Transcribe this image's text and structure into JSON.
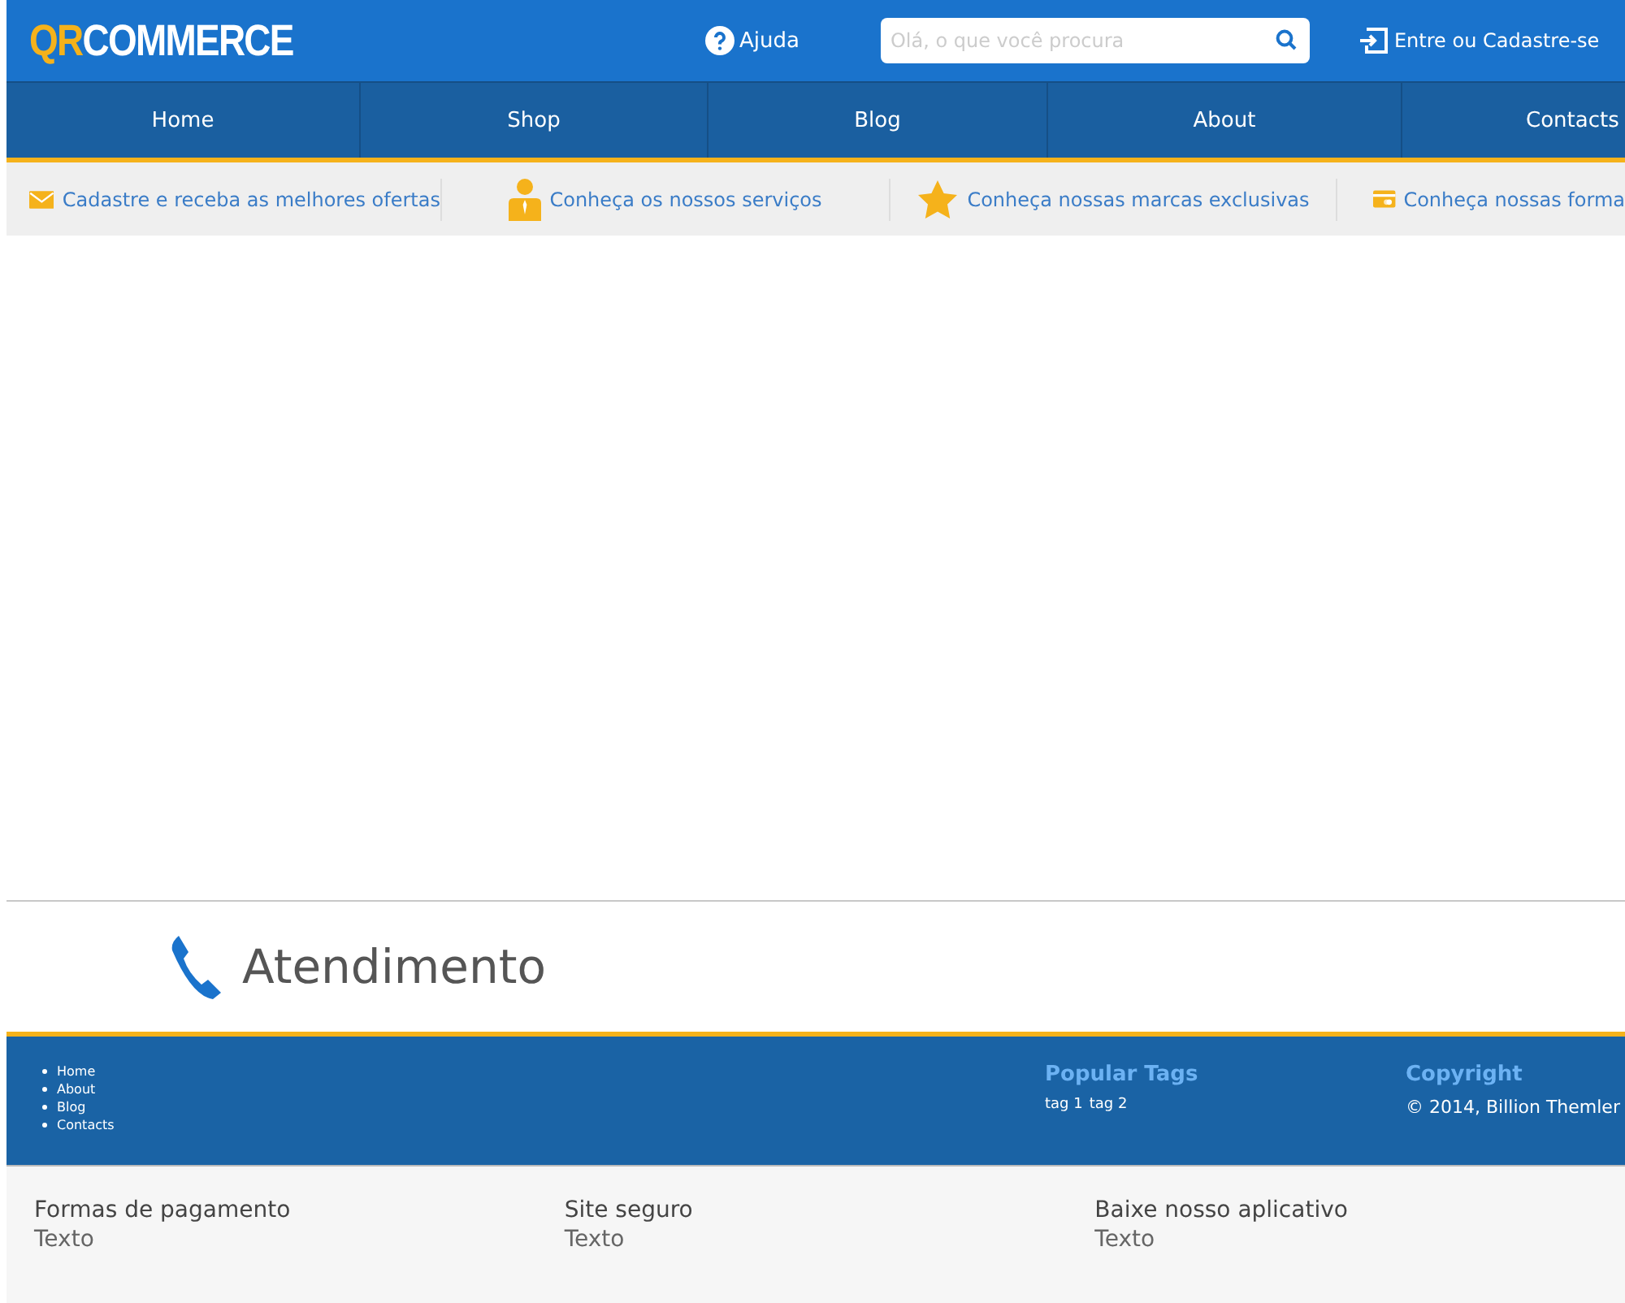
{
  "header": {
    "logo": {
      "prefix": "QR",
      "name": "COMMERCE"
    },
    "help": "Ajuda",
    "search": {
      "placeholder": "Olá, o que você procura"
    },
    "login": "Entre ou Cadastre-se"
  },
  "nav": [
    {
      "label": "Home"
    },
    {
      "label": "Shop"
    },
    {
      "label": "Blog"
    },
    {
      "label": "About"
    },
    {
      "label": "Contacts"
    }
  ],
  "promos": [
    {
      "kind": "mail",
      "label": "Cadastre e receba as melhores ofertas"
    },
    {
      "kind": "person",
      "label": "Conheça os nossos serviços"
    },
    {
      "kind": "star",
      "label": "Conheça nossas marcas exclusivas"
    },
    {
      "kind": "card",
      "label": "Conheça nossas forma"
    }
  ],
  "support": {
    "title": "Atendimento"
  },
  "footer": {
    "links": [
      "Home",
      "About",
      "Blog",
      "Contacts"
    ],
    "tags": {
      "title": "Popular Tags",
      "items": [
        "tag 1",
        "tag 2"
      ]
    },
    "copyright": {
      "title": "Copyright",
      "text": "© 2014, Billion Themler"
    }
  },
  "bottom": [
    {
      "title": "Formas de pagamento",
      "text": "Texto"
    },
    {
      "title": "Site seguro",
      "text": "Texto"
    },
    {
      "title": "Baixe nosso aplicativo",
      "text": "Texto"
    }
  ]
}
